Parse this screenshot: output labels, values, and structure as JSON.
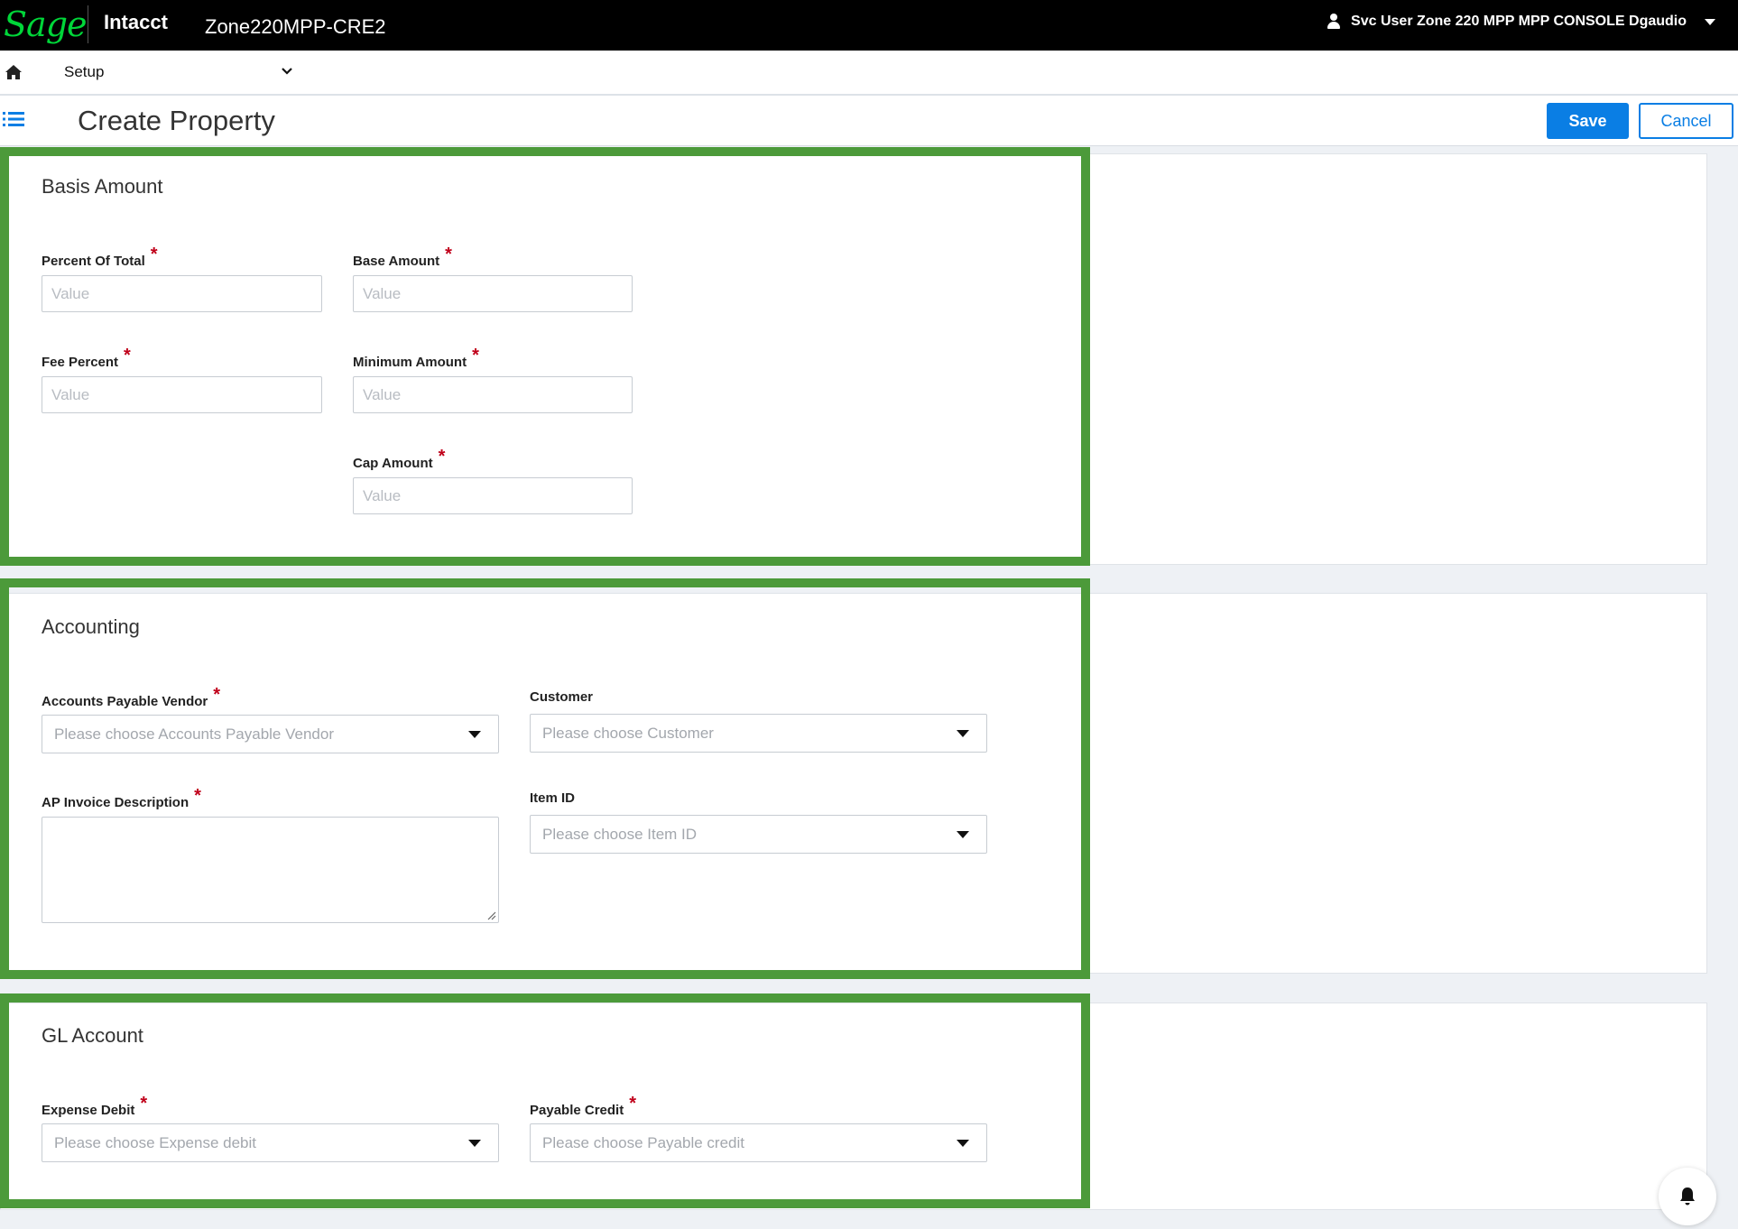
{
  "topbar": {
    "logo": "Sage",
    "product": "Intacct",
    "company": "Zone220MPP-CRE2",
    "user": "Svc User Zone 220 MPP MPP CONSOLE Dgaudio"
  },
  "nav": {
    "menu_label": "Setup"
  },
  "header": {
    "title": "Create Property",
    "save_label": "Save",
    "cancel_label": "Cancel"
  },
  "sections": {
    "basis": {
      "title": "Basis Amount",
      "percent_of_total": {
        "label": "Percent Of Total",
        "required": "*",
        "placeholder": "Value"
      },
      "base_amount": {
        "label": "Base Amount",
        "required": "*",
        "placeholder": "Value"
      },
      "fee_percent": {
        "label": "Fee Percent",
        "required": "*",
        "placeholder": "Value"
      },
      "minimum_amount": {
        "label": "Minimum Amount",
        "required": "*",
        "placeholder": "Value"
      },
      "cap_amount": {
        "label": "Cap Amount",
        "required": "*",
        "placeholder": "Value"
      }
    },
    "accounting": {
      "title": "Accounting",
      "ap_vendor": {
        "label": "Accounts Payable Vendor",
        "required": "*",
        "placeholder": "Please choose Accounts Payable Vendor"
      },
      "customer": {
        "label": "Customer",
        "placeholder": "Please choose Customer"
      },
      "ap_invoice_description": {
        "label": "AP Invoice Description",
        "required": "*"
      },
      "item_id": {
        "label": "Item ID",
        "placeholder": "Please choose Item ID"
      }
    },
    "gl_account": {
      "title": "GL Account",
      "expense_debit": {
        "label": "Expense Debit",
        "required": "*",
        "placeholder": "Please choose Expense debit"
      },
      "payable_credit": {
        "label": "Payable Credit",
        "required": "*",
        "placeholder": "Please choose Payable credit"
      }
    }
  },
  "colors": {
    "brand_green": "#00d639",
    "primary_blue": "#0a7ee4",
    "highlight_green": "#4c9a3a",
    "required_red": "#c0001a"
  },
  "icons": [
    "user-icon",
    "caret-down-icon",
    "home-icon",
    "chevron-down-icon",
    "list-icon",
    "bell-icon",
    "resize-grip-icon"
  ]
}
